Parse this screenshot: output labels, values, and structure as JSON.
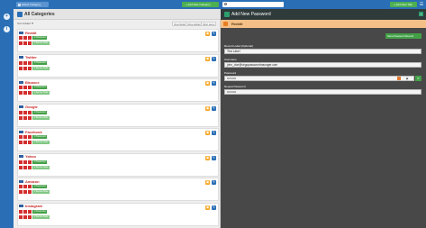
{
  "topbar": {
    "category_select": "Select Category",
    "add_category": "+ Add New Category",
    "search_placeholder": "",
    "add_folder": "+ Add New Title",
    "menu_glyph": "☰"
  },
  "sidebar": {
    "items": [
      {
        "icon": "plus-circle-icon",
        "glyph": "+"
      },
      {
        "icon": "info-circle-icon",
        "glyph": "i"
      }
    ]
  },
  "left": {
    "title": "All Categories",
    "sort_label": "Sort Added ▼",
    "view_options": [
      "View Mode",
      "Show Hidden",
      "Short Items"
    ],
    "entries": [
      {
        "name": "Reddit",
        "password_btn": "1 Password",
        "note_btn": "1 Secure Note"
      },
      {
        "name": "Twitter",
        "password_btn": "1 Password",
        "note_btn": "1 Secure Note"
      },
      {
        "name": "Binance",
        "password_btn": "1 Password",
        "note_btn": "1 Secure Note"
      },
      {
        "name": "Google",
        "password_btn": "1 Password",
        "note_btn": "1 Secure Note"
      },
      {
        "name": "Facebook",
        "password_btn": "1 Password",
        "note_btn": "1 Secure Note"
      },
      {
        "name": "Yahoo",
        "password_btn": "1 Password",
        "note_btn": "1 Secure Note"
      },
      {
        "name": "Amazon",
        "password_btn": "1 Password",
        "note_btn": "1 Secure Note"
      },
      {
        "name": "Instagram",
        "password_btn": "1 Password",
        "note_btn": "1 Secure Note"
      }
    ]
  },
  "right": {
    "title": "Add New Password",
    "close_glyph": "×",
    "entry_title": "Reddit",
    "save_button": "Save Password Record",
    "fields": {
      "label_label": "Record Label (Optional)",
      "label_value": "Test Label",
      "username_label": "Username",
      "username_value": "john_doe@virgopasswordmanager.com",
      "password_label": "Password",
      "password_value": "•••••••••",
      "repeat_label": "Repeat Password",
      "repeat_value": "•••••••••"
    }
  },
  "colors": {
    "brand_blue": "#2a6fb5",
    "success_green": "#43a047",
    "danger_red": "#d32f2f",
    "warn_orange": "#f5a623"
  }
}
